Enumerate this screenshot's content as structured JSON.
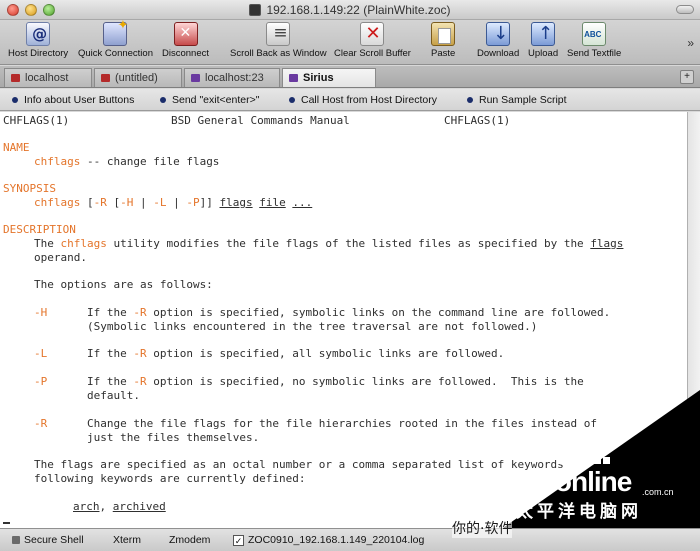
{
  "window": {
    "title": "192.168.1.149:22 (PlainWhite.zoc)"
  },
  "toolbar": {
    "items": [
      {
        "label": "Host Directory",
        "icon": "host-directory-icon"
      },
      {
        "label": "Quick Connection",
        "icon": "quick-connection-icon"
      },
      {
        "label": "Disconnect",
        "icon": "disconnect-icon"
      },
      {
        "label": "Scroll Back as Window",
        "icon": "scroll-back-icon"
      },
      {
        "label": "Clear Scroll Buffer",
        "icon": "clear-buffer-icon"
      },
      {
        "label": "Paste",
        "icon": "paste-icon"
      },
      {
        "label": "Download",
        "icon": "download-icon"
      },
      {
        "label": "Upload",
        "icon": "upload-icon"
      },
      {
        "label": "Send Textfile",
        "icon": "send-textfile-icon"
      }
    ]
  },
  "tabs": [
    {
      "label": "localhost",
      "icon_color": "#b42a2a"
    },
    {
      "label": "(untitled)",
      "icon_color": "#b42a2a"
    },
    {
      "label": "localhost:23",
      "icon_color": "#6a3aa0"
    },
    {
      "label": "Sirius",
      "icon_color": "#6a3aa0",
      "active": true
    }
  ],
  "button_bar": {
    "items": [
      {
        "label": "Info about User Buttons"
      },
      {
        "label": "Send \"exit<enter>\""
      },
      {
        "label": "Call Host from Host Directory"
      },
      {
        "label": "Run Sample Script"
      }
    ]
  },
  "terminal": {
    "text_color": "#2f2f2f",
    "accent_color": "#e4752b",
    "header": {
      "left": "CHFLAGS(1)",
      "center": "BSD General Commands Manual",
      "right": "CHFLAGS(1)"
    },
    "name_heading": "NAME",
    "name_line": {
      "cmd": "chflags",
      "rest": " -- change file flags"
    },
    "synopsis_heading": "SYNOPSIS",
    "synopsis": {
      "cmd": "chflags",
      "open": " [",
      "opt_r": "-R",
      "mid1": " [",
      "opt_h": "-H",
      "sep1": " | ",
      "opt_l": "-L",
      "sep2": " | ",
      "opt_p": "-P",
      "close": "]] ",
      "arg_flags": "flags",
      "arg_file": "file",
      "arg_more": "..."
    },
    "description_heading": "DESCRIPTION",
    "desc1": {
      "pre": "The ",
      "cmd": "chflags",
      "mid": " utility modifies the file flags of the listed files as specified by the ",
      "link": "flags"
    },
    "desc1b": "operand.",
    "options_intro": "The options are as follows:",
    "opt_h": {
      "flag": "-H",
      "pre": "If the ",
      "ref": "-R",
      "post": " option is specified, symbolic links on the command line are followed.",
      "line2": "(Symbolic links encountered in the tree traversal are not followed.)"
    },
    "opt_l": {
      "flag": "-L",
      "pre": "If the ",
      "ref": "-R",
      "post": " option is specified, all symbolic links are followed."
    },
    "opt_p": {
      "flag": "-P",
      "pre": "If the ",
      "ref": "-R",
      "post": " option is specified, no symbolic links are followed.  This is the",
      "line2": "default."
    },
    "opt_r": {
      "flag": "-R",
      "text": "Change the file flags for the file hierarchies rooted in the files instead of",
      "line2": "just the files themselves."
    },
    "flags_para1": "The flags are specified as an octal number or a comma separated list of keywords",
    "flags_para2": "following keywords are currently defined:",
    "kw_line": {
      "a": "arch",
      "sep": ", ",
      "b": "archived"
    }
  },
  "statusbar": {
    "items": [
      {
        "label": "Secure Shell"
      },
      {
        "label": "Xterm"
      },
      {
        "label": "Zmodem"
      },
      {
        "label": "ZOC0910_192.168.1.149_220104.log",
        "checked": true
      }
    ]
  },
  "watermark": {
    "brand": "PConline",
    "domain": ".com.cn",
    "cn_name": "太平洋电脑网",
    "cn_left": "你的·软件"
  }
}
